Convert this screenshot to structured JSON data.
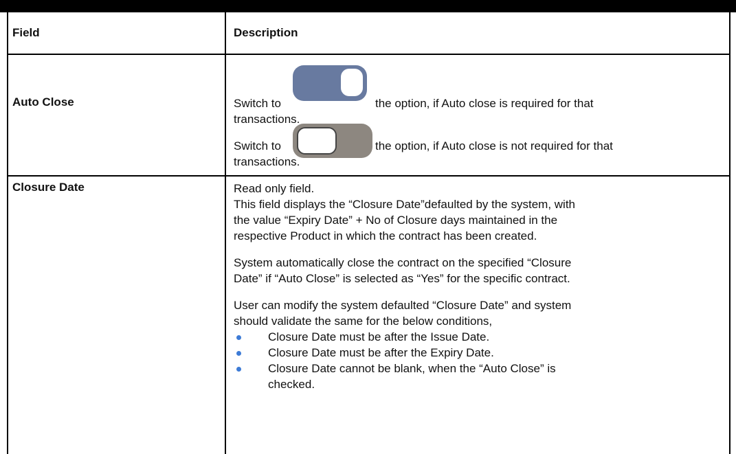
{
  "table": {
    "headers": {
      "field": "Field",
      "description": "Description"
    },
    "rows": [
      {
        "field": "Auto Close",
        "switch_on": {
          "pre": "Switch to",
          "post": "the option, if Auto close is required for that",
          "cont": "transactions.",
          "toggle_color": "#687aa0"
        },
        "switch_off": {
          "pre": "Switch to",
          "post": "the option, if Auto close is not required for that",
          "cont": "transactions.",
          "toggle_color": "#8d8780"
        }
      },
      {
        "field": "Closure Date",
        "p1": "Read only field.",
        "p2_l1": "This field displays the “Closure Date”defaulted by the system, with",
        "p2_l2": "the value “Expiry Date” + No of Closure days maintained in the",
        "p2_l3": "respective Product in which the contract has been created.",
        "p3_l1": "System automatically close the contract on the specified “Closure",
        "p3_l2": "Date” if “Auto Close” is selected as “Yes” for the specific contract.",
        "p4_l1": "User can modify the system defaulted “Closure Date” and system",
        "p4_l2": "should validate the same for the below conditions,",
        "bullets": [
          "Closure Date must be after the Issue Date.",
          "Closure Date must be after the Expiry Date.",
          "Closure Date cannot be blank, when the “Auto Close” is checked."
        ],
        "bullet3_l1": "Closure Date cannot be blank, when the “Auto Close” is",
        "bullet3_l2": "checked.",
        "bullet_color": "#3d7bd6"
      }
    ]
  }
}
